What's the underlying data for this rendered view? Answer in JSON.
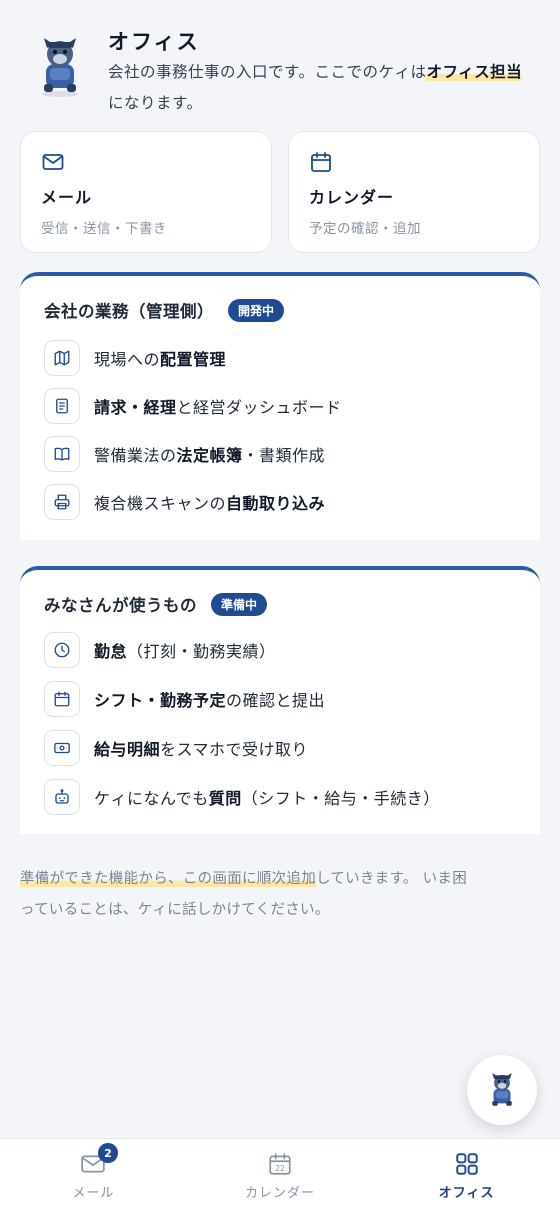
{
  "header": {
    "title": "オフィス",
    "intro_before": "会社の事務仕事の入口です。ここでのケィは",
    "intro_highlight": "オフィス担当",
    "intro_after": "になります。"
  },
  "cards": [
    {
      "title": "メール",
      "sub": "受信・送信・下書き",
      "icon": "mail-icon"
    },
    {
      "title": "カレンダー",
      "sub": "予定の確認・追加",
      "icon": "calendar-icon"
    }
  ],
  "panel_company": {
    "title": "会社の業務（管理側）",
    "badge": "開発中",
    "items": [
      {
        "pre": "現場への",
        "bold": "配置管理",
        "post": "",
        "icon": "map-icon"
      },
      {
        "pre": "",
        "bold": "請求・経理",
        "post": "と経営ダッシュボード",
        "icon": "document-icon"
      },
      {
        "pre": "警備業法の",
        "bold": "法定帳簿",
        "post": "・書類作成",
        "icon": "book-icon"
      },
      {
        "pre": "複合機スキャンの",
        "bold": "自動取り込み",
        "post": "",
        "icon": "printer-icon"
      }
    ]
  },
  "panel_staff": {
    "title": "みなさんが使うもの",
    "badge": "準備中",
    "items": [
      {
        "pre": "",
        "bold": "勤怠",
        "post": "（打刻・勤務実績）",
        "icon": "clock-icon"
      },
      {
        "pre": "",
        "bold": "シフト・勤務予定",
        "post": "の確認と提出",
        "icon": "calendar-icon"
      },
      {
        "pre": "",
        "bold": "給与明細",
        "post": "をスマホで受け取り",
        "icon": "money-icon"
      },
      {
        "pre": "ケィになんでも",
        "bold": "質問",
        "post": "（シフト・給与・手続き）",
        "icon": "robot-icon"
      }
    ]
  },
  "note": {
    "highlight": "準備ができた機能から、この画面に順次追加",
    "rest": "していきます。 いま困っていることは、ケィに話しかけてください。"
  },
  "tabbar": {
    "tabs": [
      {
        "label": "メール",
        "badge": "2",
        "icon": "mail-icon"
      },
      {
        "label": "カレンダー",
        "icon": "calendar-icon",
        "day": "22"
      },
      {
        "label": "オフィス",
        "icon": "grid-icon",
        "active": true
      }
    ]
  },
  "colors": {
    "accent": "#204a91",
    "highlight": "#fde7a3",
    "background": "#f3f5f9"
  }
}
